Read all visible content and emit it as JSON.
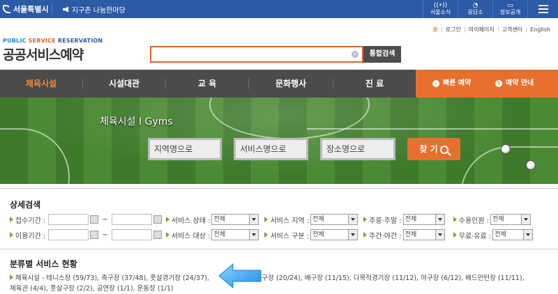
{
  "topbar": {
    "seoul_label": "서울특별시",
    "notice": "지구촌 나눔한마당",
    "links": [
      {
        "label": "서울소식",
        "icon": "broadcast-icon"
      },
      {
        "label": "응답소",
        "icon": "chat-icon"
      },
      {
        "label": "정보공개",
        "icon": "document-icon"
      }
    ]
  },
  "util_links": [
    "홈",
    "로그인",
    "마이페이지",
    "고객센터",
    "English"
  ],
  "logo": {
    "sub1": "PUBLIC",
    "sub2": "SERVICE",
    "sub3": "RESERVATION",
    "main": "공공서비스예약"
  },
  "search": {
    "value": "",
    "placeholder": "",
    "button": "통합검색"
  },
  "nav": {
    "items": [
      "체육시설",
      "시설대관",
      "교  육",
      "문화행사",
      "진  료"
    ],
    "quick_reserve": "빠른 예약",
    "reserve_guide": "예약 안내"
  },
  "banner": {
    "title": "체육시설 I Gyms",
    "buttons": [
      "지역명으로",
      "서비스명으로",
      "장소명으로"
    ],
    "go": "찾 기"
  },
  "detail": {
    "title": "상세검색",
    "row1": {
      "period_label": "접수기간 :",
      "tilde": "~",
      "fields": [
        {
          "label": "서비스 상태 :",
          "value": "전체"
        },
        {
          "label": "서비스 지역 :",
          "value": "전체"
        },
        {
          "label": "주중·주말 :",
          "value": "전체"
        },
        {
          "label": "수용인원 :",
          "value": "전체"
        }
      ]
    },
    "row2": {
      "period_label": "이용기간 :",
      "tilde": "~",
      "fields": [
        {
          "label": "서비스 대상 :",
          "value": "전체"
        },
        {
          "label": "서비스 구분 :",
          "value": "전체"
        },
        {
          "label": "주간·야간 :",
          "value": "전체"
        },
        {
          "label": "무료·유료 :",
          "value": "전체"
        }
      ]
    }
  },
  "category": {
    "title": "분류별 서비스 현황",
    "line1": "체육시설 - 테니스장 (59/73), 축구장 (37/48), 풋살경기장 (24/37),",
    "line1b": "9), 농구장 (20/24), 배구장 (11/15), 다목적경기장 (11/12), 야구장 (6/12), 배드민턴장 (11/11),",
    "line2": "체육관 (4/4), 풋살구장 (2/2), 공연장 (1/1), 운동장 (1/1)"
  }
}
